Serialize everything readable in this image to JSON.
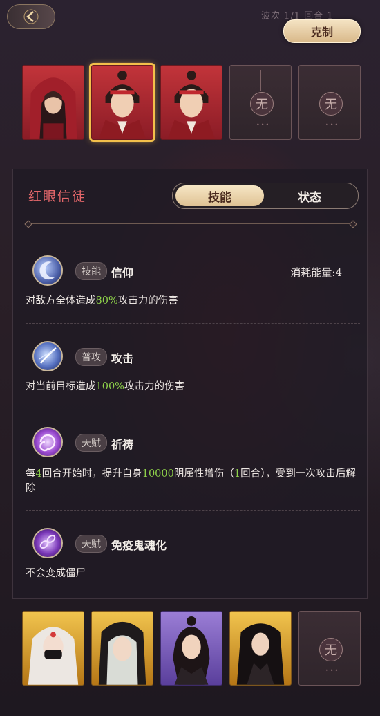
{
  "header": {
    "round_info": "波次 1/1 回合 1",
    "counter_button": "克制"
  },
  "top_team": [
    {
      "rarity": "red",
      "empty": false
    },
    {
      "rarity": "red",
      "empty": false,
      "selected": true
    },
    {
      "rarity": "red",
      "empty": false
    },
    {
      "rarity": "none",
      "empty": true,
      "label": "无"
    },
    {
      "rarity": "none",
      "empty": true,
      "label": "无"
    }
  ],
  "panel": {
    "character_name": "红眼信徒",
    "tabs": [
      {
        "label": "技能",
        "active": true
      },
      {
        "label": "状态",
        "active": false
      }
    ],
    "skills": [
      {
        "icon": "moon-crescent-icon",
        "tag": "技能",
        "name": "信仰",
        "cost": "消耗能量:4",
        "desc_pre": "对敌方全体造成",
        "desc_hl": "80%",
        "desc_post": "攻击力的伤害"
      },
      {
        "icon": "slash-orb-icon",
        "tag": "普攻",
        "name": "攻击",
        "desc_pre": "对当前目标造成",
        "desc_hl": "100%",
        "desc_post": "攻击力的伤害"
      },
      {
        "icon": "purple-swirl-icon",
        "tag": "天赋",
        "name": "祈祷",
        "desc_a": "每",
        "desc_hl1": "4",
        "desc_b": "回合开始时，提升自身",
        "desc_hl2": "10000",
        "desc_c": "阴属性增伤（",
        "desc_hl3": "1",
        "desc_d": "回合），受到一次攻击后解除"
      },
      {
        "icon": "chain-icon",
        "tag": "天赋",
        "name": "免疫鬼魂化",
        "desc": "不会变成僵尸"
      }
    ]
  },
  "bottom_team": [
    {
      "rarity": "gold",
      "empty": false
    },
    {
      "rarity": "gold",
      "empty": false
    },
    {
      "rarity": "purple",
      "empty": false
    },
    {
      "rarity": "gold",
      "empty": false
    },
    {
      "rarity": "none",
      "empty": true,
      "label": "无"
    }
  ],
  "colors": {
    "accent_gold": "#f3c04b",
    "highlight_green": "#8ed14a",
    "name_red": "#e4676a"
  }
}
